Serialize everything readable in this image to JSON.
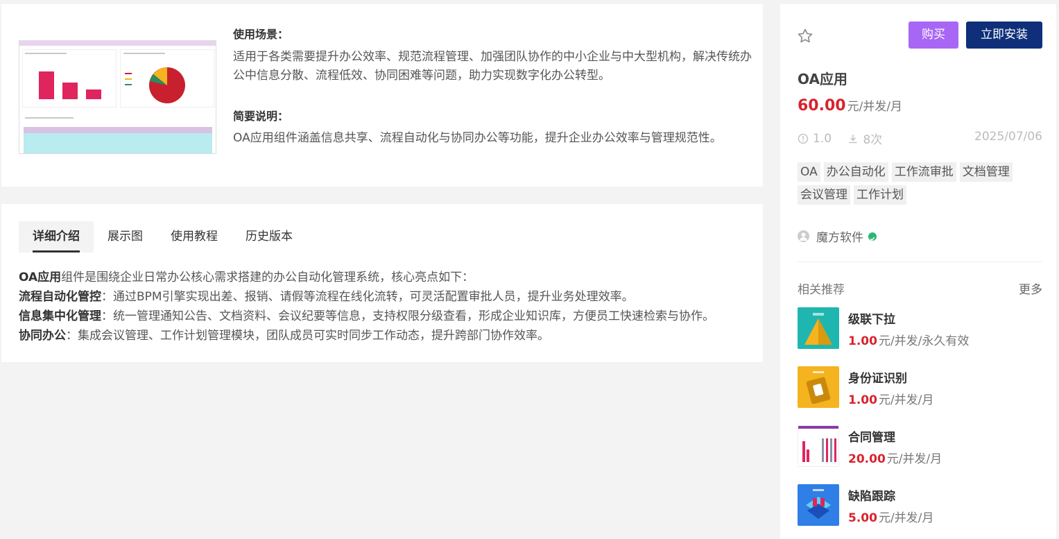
{
  "intro": {
    "scene_title": "使用场景：",
    "scene_text": "适用于各类需要提升办公效率、规范流程管理、加强团队协作的中小企业与中大型机构，解决传统办公中信息分散、流程低效、协同困难等问题，助力实现数字化办公转型。",
    "brief_title": "简要说明：",
    "brief_text": "OA应用组件涵盖信息共享、流程自动化与协同办公等功能，提升企业办公效率与管理规范性。"
  },
  "tabs": [
    {
      "label": "详细介绍",
      "active": true
    },
    {
      "label": "展示图",
      "active": false
    },
    {
      "label": "使用教程",
      "active": false
    },
    {
      "label": "历史版本",
      "active": false
    }
  ],
  "detail": [
    {
      "bold": "OA应用",
      "text": "组件是围绕企业日常办公核心需求搭建的办公自动化管理系统，核心亮点如下："
    },
    {
      "bold": "流程自动化管控",
      "text": "：通过BPM引擎实现出差、报销、请假等流程在线化流转，可灵活配置审批人员，提升业务处理效率。"
    },
    {
      "bold": "信息集中化管理",
      "text": "：统一管理通知公告、文档资料、会议纪要等信息，支持权限分级查看，形成企业知识库，方便员工快速检索与协作。"
    },
    {
      "bold": "协同办公",
      "text": "：集成会议管理、工作计划管理模块，团队成员可实时同步工作动态，提升跨部门协作效率。"
    }
  ],
  "product": {
    "buy_label": "购买",
    "install_label": "立即安装",
    "title": "OA应用",
    "price": "60.00",
    "price_unit": "元/并发/月",
    "version": "1.0",
    "downloads": "8次",
    "date": "2025/07/06",
    "tags": [
      "OA",
      "办公自动化",
      "工作流审批",
      "文档管理",
      "会议管理",
      "工作计划"
    ],
    "vendor": "魔方软件"
  },
  "related": {
    "title": "相关推荐",
    "more": "更多",
    "items": [
      {
        "name": "级联下拉",
        "price": "1.00",
        "unit": "元/并发/永久有效",
        "thumb_color": "#1fb6b0"
      },
      {
        "name": "身份证识别",
        "price": "1.00",
        "unit": "元/并发/月",
        "thumb_color": "#f4b31f"
      },
      {
        "name": "合同管理",
        "price": "20.00",
        "unit": "元/并发/月",
        "thumb_color": "#ffffff"
      },
      {
        "name": "缺陷跟踪",
        "price": "5.00",
        "unit": "元/并发/月",
        "thumb_color": "#2f7fe6"
      }
    ]
  },
  "colors": {
    "accent_purple": "#a866f4",
    "accent_navy": "#0f2f7a",
    "price_red": "#d9232e",
    "verified_green": "#2bb673"
  },
  "icons": [
    "star-icon",
    "info-icon",
    "download-icon",
    "user-avatar-icon",
    "verified-check-icon"
  ]
}
